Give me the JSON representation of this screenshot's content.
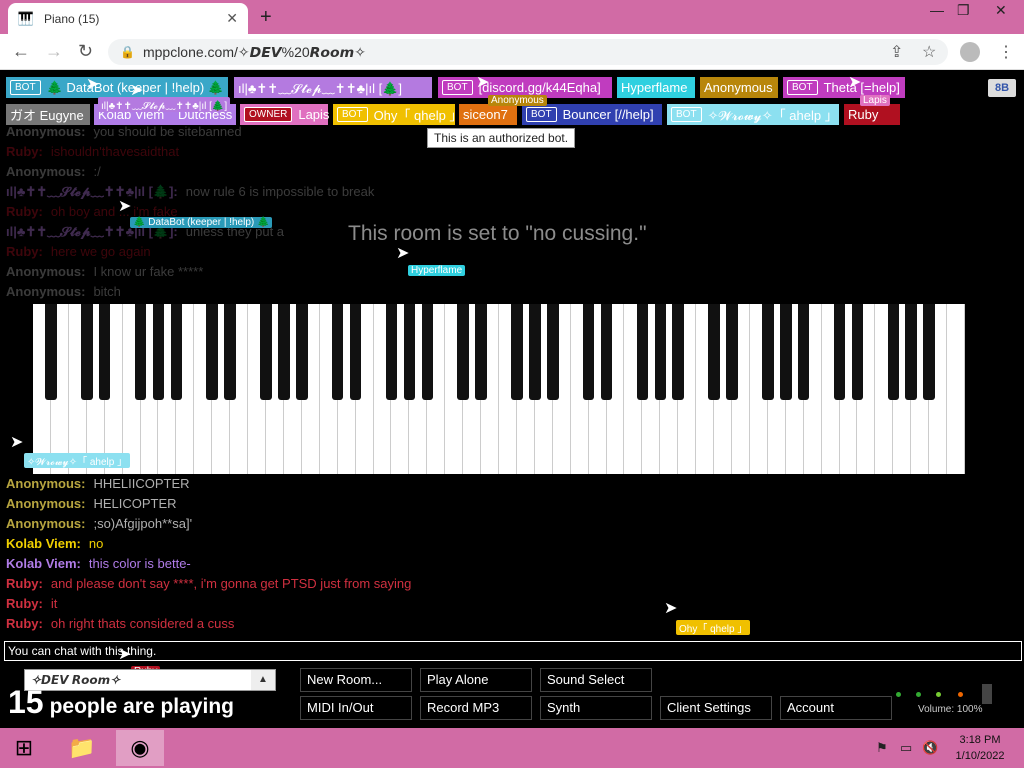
{
  "browser": {
    "tab_title": "Piano (15)",
    "tab_close": "✕",
    "new_tab": "+",
    "url": "mppclone.com/✧𝘿𝙀𝙑%20𝙍𝙤𝙤𝙢✧",
    "window_controls": [
      "—",
      "❐",
      "✕"
    ]
  },
  "userlist": [
    {
      "badge": "BOT",
      "name": "🌲 DataBot (keeper | !help) 🌲",
      "color": "#3aa7c8"
    },
    {
      "badge": "",
      "name": "ıl|♣✝✝﹏𝓢𝓽𝓮𝓹﹏✝✝♣|ıl [🌲]",
      "color": "#b47ae0"
    },
    {
      "badge": "BOT",
      "name": "[discord.gg/k44Eqha]",
      "color": "#c03cbf"
    },
    {
      "badge": "",
      "name": "Hyperflame",
      "color": "#2fd0e0"
    },
    {
      "badge": "",
      "name": "Anonymous",
      "color": "#b8860b"
    },
    {
      "badge": "BOT",
      "name": "Theta [=help]",
      "color": "#c03cbf"
    },
    {
      "badge": "",
      "name": "ガオ Eugyne",
      "color": "#777777"
    },
    {
      "badge": "",
      "name": "Kolab Viem",
      "color": "#b07ce8"
    },
    {
      "badge": "",
      "name": "Dutchess",
      "color": "#b07ce8"
    },
    {
      "badge": "OWNER",
      "name": "Lapis",
      "color": "#e070c0"
    },
    {
      "badge": "BOT",
      "name": "Ohy「 qhelp 」",
      "color": "#f0c000"
    },
    {
      "badge": "",
      "name": "siceon7",
      "color": "#e07010"
    },
    {
      "badge": "BOT",
      "name": "Bouncer [//help]",
      "color": "#3040b0"
    },
    {
      "badge": "BOT",
      "name": "✧𝓦𝓻𝓸𝔀𝔂✧「 ahelp 」",
      "color": "#8ce0f0"
    },
    {
      "badge": "",
      "name": "Ruby",
      "color": "#b01020"
    }
  ],
  "topright_button": "8B",
  "tooltip": "This is an authorized bot.",
  "notice": "This room is set to \"no cussing.\"",
  "chat": [
    {
      "nick": "Anonymous:",
      "text": "you should be sitebanned",
      "nick_color": "#aaaaaa",
      "text_color": "#aaaaaa",
      "dim": true
    },
    {
      "nick": "Ruby:",
      "text": "ishouldn'thavesaidthat",
      "nick_color": "#b01020",
      "text_color": "#b01020",
      "dim": true
    },
    {
      "nick": "Anonymous:",
      "text": ":/",
      "nick_color": "#aaaaaa",
      "text_color": "#aaaaaa",
      "dim": true
    },
    {
      "nick": "ıl|♣✝✝﹏𝓢𝓽𝓮𝓹﹏✝✝♣|ıl [🌲]:",
      "text": "now rule 6 is impossible to break",
      "nick_color": "#b47ae0",
      "text_color": "#aaaaaa",
      "dim": true
    },
    {
      "nick": "Ruby:",
      "text": "oh boy and ... i'm fake",
      "nick_color": "#b01020",
      "text_color": "#b01020",
      "dim": true
    },
    {
      "nick": "ıl|♣✝✝﹏𝓢𝓽𝓮𝓹﹏✝✝♣|ıl [🌲]:",
      "text": "unless they put a",
      "nick_color": "#b47ae0",
      "text_color": "#aaaaaa",
      "dim": true
    },
    {
      "nick": "Ruby:",
      "text": "here we go again",
      "nick_color": "#b01020",
      "text_color": "#b01020",
      "dim": true
    },
    {
      "nick": "Anonymous:",
      "text": "I know ur fake *****",
      "nick_color": "#aaaaaa",
      "text_color": "#aaaaaa",
      "dim": true
    },
    {
      "nick": "Anonymous:",
      "text": "bitch",
      "nick_color": "#aaaaaa",
      "text_color": "#aaaaaa",
      "dim": true
    }
  ],
  "chat_bottom": [
    {
      "nick": "Anonymous:",
      "text": "HHELIICOPTER",
      "nick_color": "#b8a640",
      "text_color": "#b0b0b0"
    },
    {
      "nick": "Anonymous:",
      "text": "HELICOPTER",
      "nick_color": "#b8a640",
      "text_color": "#b0b0b0"
    },
    {
      "nick": "Anonymous:",
      "text": ";so)Afgijpoh**sa]'",
      "nick_color": "#b8a640",
      "text_color": "#b0b0b0"
    },
    {
      "nick": "Kolab Viem:",
      "text": "no",
      "nick_color": "#f0d000",
      "text_color": "#f0d000"
    },
    {
      "nick": "Kolab Viem:",
      "text": "this color is bette-",
      "nick_color": "#b07ce8",
      "text_color": "#b07ce8"
    },
    {
      "nick": "Ruby:",
      "text": "and please don't say ****, i'm gonna get PTSD just from saying",
      "nick_color": "#d03040",
      "text_color": "#d03040"
    },
    {
      "nick": "Ruby:",
      "text": "it",
      "nick_color": "#d03040",
      "text_color": "#d03040"
    },
    {
      "nick": "Ruby:",
      "text": "oh right thats considered a cuss",
      "nick_color": "#d03040",
      "text_color": "#d03040"
    }
  ],
  "cursor_tags": {
    "databot": "🌲 DataBot (keeper | !help) 🌲",
    "step": "ıl|♣✝✝﹏𝓢𝓽𝓮𝓹﹏✝✝♣|ıl [🌲]",
    "anonymous": "Anonymous",
    "lapis": "Lapis",
    "hyperflame": "Hyperflame",
    "wrowy": "✧𝓦𝓻𝓸𝔀𝔂✧「 ahelp 」",
    "ohy": "Ohy「 qhelp 」",
    "ruby": "Ruby"
  },
  "chat_input_placeholder": "You can chat with this thing.",
  "room": {
    "name": "✧𝘿𝙀𝙑 𝙍𝙤𝙤𝙢✧",
    "count": "15",
    "count_text": "people are playing"
  },
  "buttons": {
    "new_room": "New Room...",
    "play_alone": "Play Alone",
    "sound_select": "Sound Select",
    "midi": "MIDI In/Out",
    "record": "Record MP3",
    "synth": "Synth",
    "client_settings": "Client Settings",
    "account": "Account"
  },
  "volume": "Volume: 100%",
  "taskbar": {
    "time": "3:18 PM",
    "date": "1/10/2022"
  }
}
